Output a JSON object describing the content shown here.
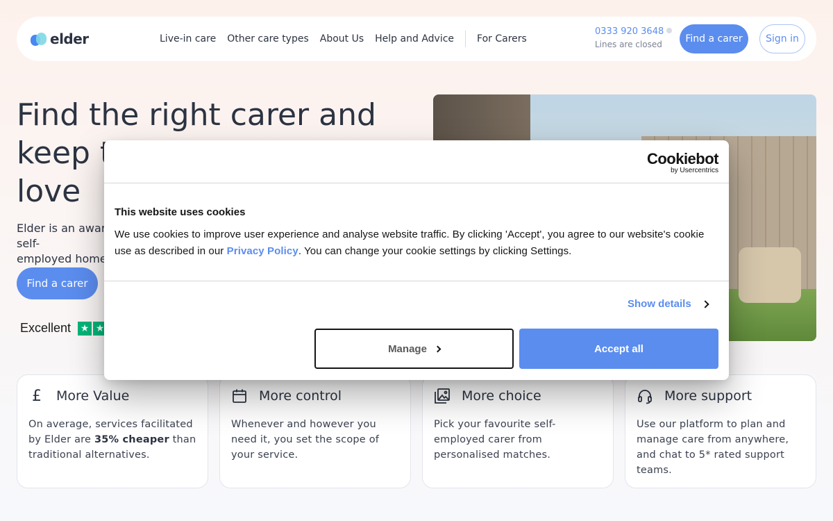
{
  "header": {
    "logo_text": "elder",
    "nav": [
      "Live-in care",
      "Other care types",
      "About Us",
      "Help and Advice",
      "For Carers"
    ],
    "phone_number": "0333 920 3648",
    "phone_status": "Lines are closed",
    "find_carer_label": "Find a carer",
    "sign_in_label": "Sign in"
  },
  "hero": {
    "title_line1": "Find the right carer and",
    "title_line2": "keep the life you love",
    "title_line3": "love",
    "subtitle_line1": "Elder is an award-winning introductory service connecting you with self-",
    "subtitle_line2": "employed home carers",
    "find_carer_label": "Find a carer",
    "trust_label": "Excellent"
  },
  "cookie": {
    "brand": "Cookiebot",
    "brand_by": "by Usercentrics",
    "title": "This website uses cookies",
    "body_before": "We use cookies to improve user experience and analyse website traffic. By clicking 'Accept', you agree to our website's cookie use as described in our ",
    "privacy_link": "Privacy Policy",
    "body_after": ". You can change your cookie settings by clicking Settings.",
    "show_details": "Show details",
    "manage": "Manage",
    "accept_all": "Accept all"
  },
  "cards": [
    {
      "icon": "pound-icon",
      "title": "More Value",
      "text_before": "On average, services facilitated by Elder are ",
      "text_bold": "35% cheaper",
      "text_after": " than traditional alternatives."
    },
    {
      "icon": "calendar-icon",
      "title": "More control",
      "text": "Whenever and however you need it, you set the scope of your service."
    },
    {
      "icon": "gallery-icon",
      "title": "More choice",
      "text": "Pick your favourite self-employed carer from personalised matches."
    },
    {
      "icon": "headset-icon",
      "title": "More support",
      "text": "Use our platform to plan and manage care from anywhere, and chat to 5* rated support teams."
    }
  ],
  "colors": {
    "accent": "#5b8def",
    "trustpilot": "#00b67a",
    "text": "#2c3342"
  }
}
